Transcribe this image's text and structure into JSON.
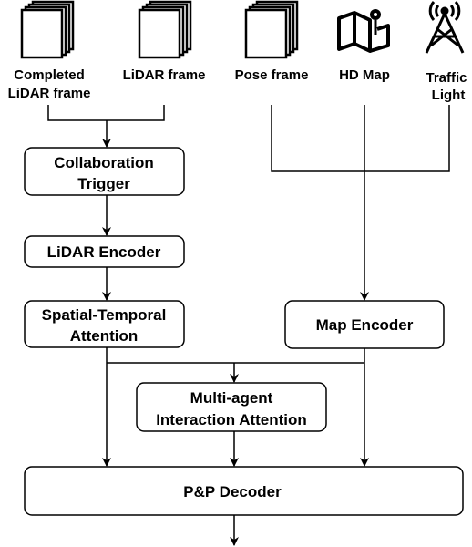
{
  "inputs": [
    {
      "label_lines": [
        "Completed",
        "LiDAR frame"
      ],
      "icon": "stacked-frames-icon"
    },
    {
      "label_lines": [
        "LiDAR frame"
      ],
      "icon": "stacked-frames-icon"
    },
    {
      "label_lines": [
        "Pose frame"
      ],
      "icon": "stacked-frames-icon"
    },
    {
      "label_lines": [
        "HD Map"
      ],
      "icon": "map-pin-icon"
    },
    {
      "label_lines": [
        "Traffic",
        "Light"
      ],
      "icon": "signal-tower-icon"
    }
  ],
  "boxes": {
    "collaboration_trigger": [
      "Collaboration",
      "Trigger"
    ],
    "lidar_encoder": [
      "LiDAR Encoder"
    ],
    "spatial_temporal": [
      "Spatial-Temporal",
      "Attention"
    ],
    "map_encoder": [
      "Map Encoder"
    ],
    "multi_agent": [
      "Multi-agent",
      "Interaction Attention"
    ],
    "decoder": [
      "P&P Decoder"
    ]
  }
}
